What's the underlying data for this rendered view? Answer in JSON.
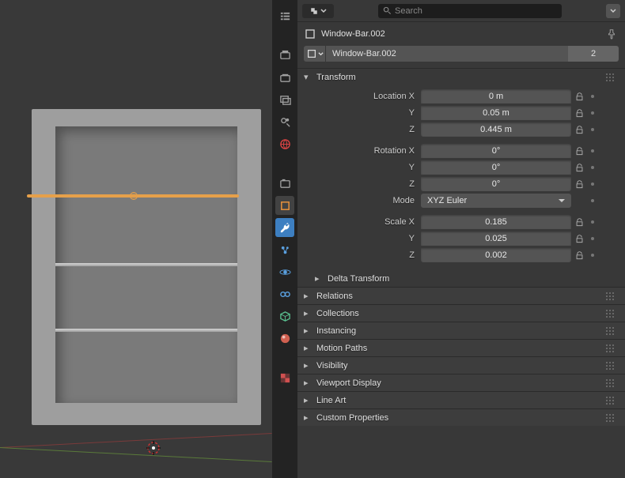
{
  "search": {
    "placeholder": "Search"
  },
  "breadcrumb": {
    "object_name": "Window-Bar.002"
  },
  "datablock": {
    "name": "Window-Bar.002",
    "users": "2"
  },
  "sections": {
    "transform": "Transform",
    "delta_transform": "Delta Transform",
    "relations": "Relations",
    "collections": "Collections",
    "instancing": "Instancing",
    "motion_paths": "Motion Paths",
    "visibility": "Visibility",
    "viewport_display": "Viewport Display",
    "line_art": "Line Art",
    "custom_properties": "Custom Properties"
  },
  "transform": {
    "location_label": "Location X",
    "location_y_label": "Y",
    "location_z_label": "Z",
    "location_x": "0 m",
    "location_y": "0.05 m",
    "location_z": "0.445 m",
    "rotation_label": "Rotation X",
    "rotation_y_label": "Y",
    "rotation_z_label": "Z",
    "rotation_x": "0°",
    "rotation_y": "0°",
    "rotation_z": "0°",
    "mode_label": "Mode",
    "mode_value": "XYZ Euler",
    "scale_label": "Scale X",
    "scale_y_label": "Y",
    "scale_z_label": "Z",
    "scale_x": "0.185",
    "scale_y": "0.025",
    "scale_z": "0.002"
  }
}
